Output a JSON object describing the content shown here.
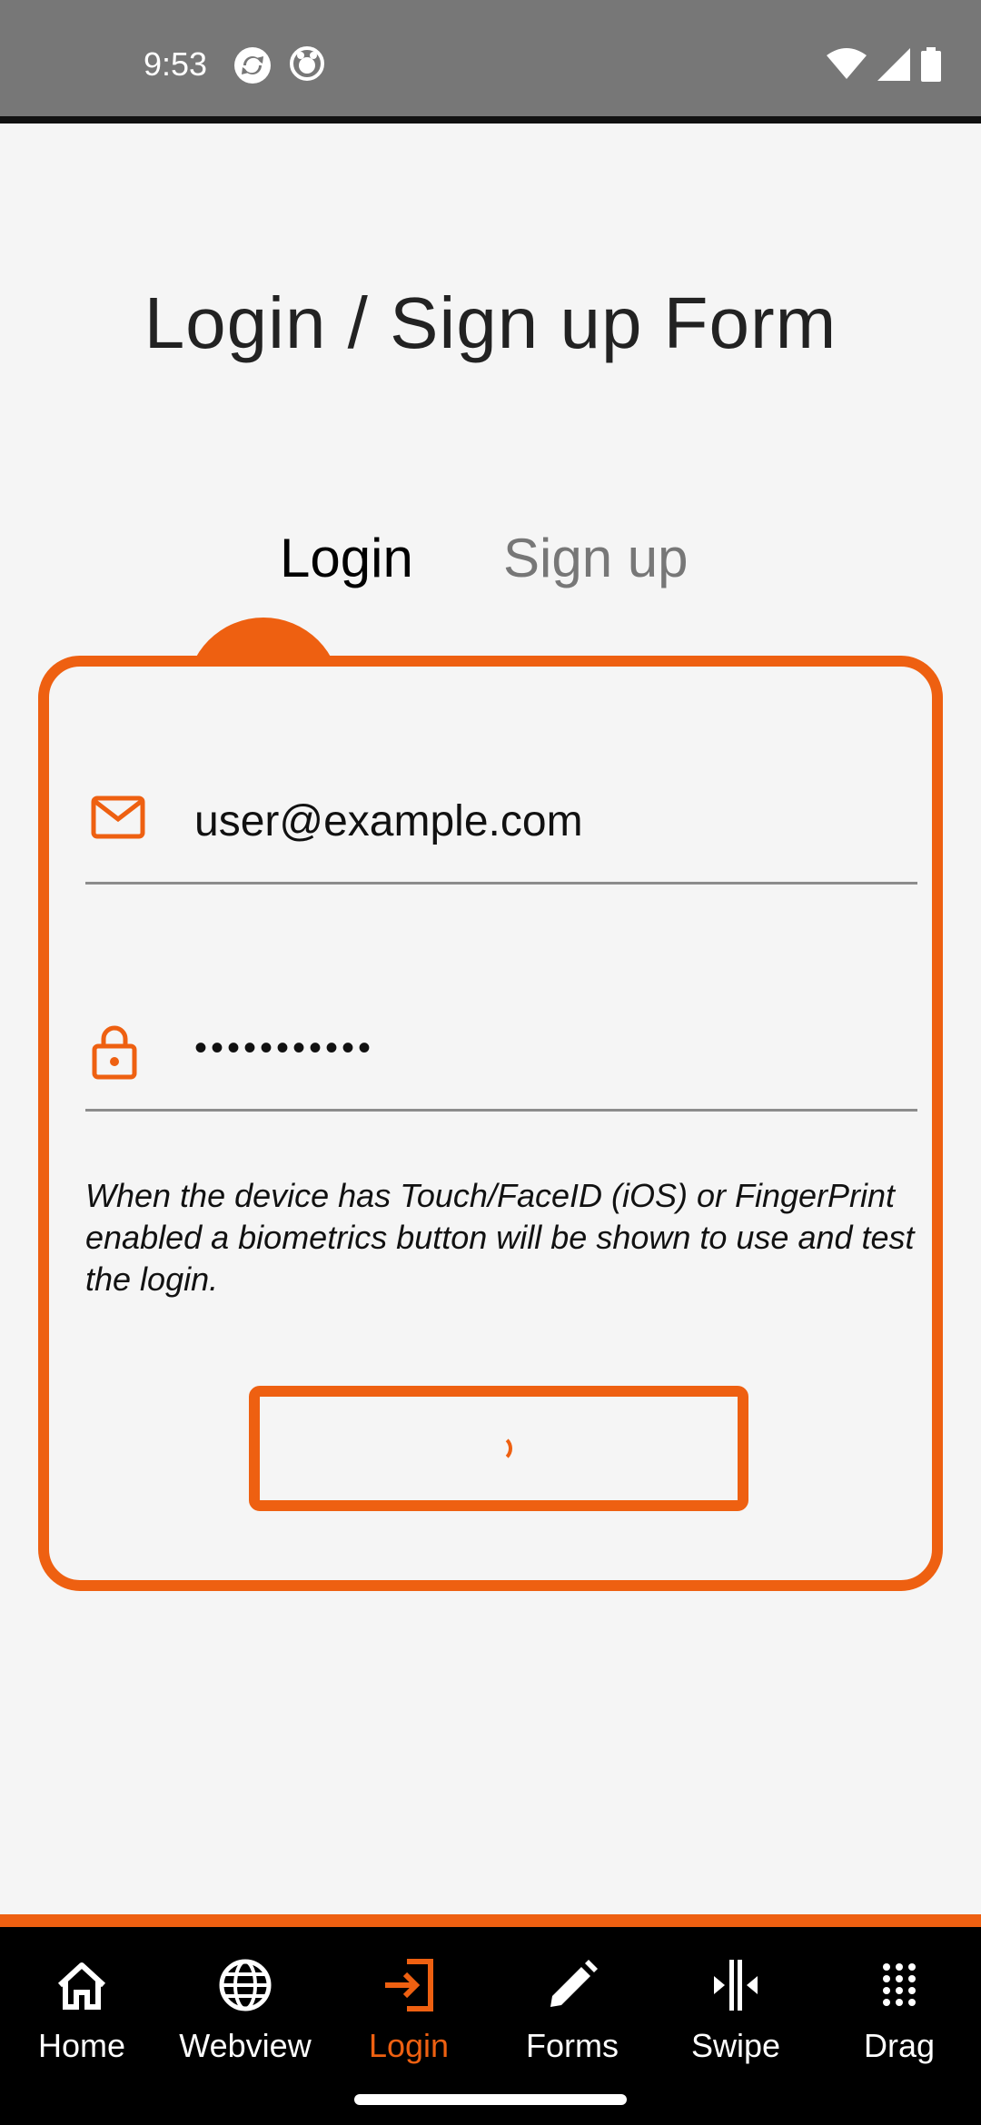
{
  "status_bar": {
    "time": "9:53",
    "left_icons": [
      "sync-icon",
      "app-icon"
    ],
    "right_icons": [
      "wifi-icon",
      "signal-icon",
      "battery-icon"
    ]
  },
  "title": "Login / Sign up Form",
  "tabs": [
    {
      "label": "Login",
      "active": true
    },
    {
      "label": "Sign up",
      "active": false
    }
  ],
  "form": {
    "email": {
      "icon": "mail-icon",
      "value": "user@example.com"
    },
    "password": {
      "icon": "lock-icon",
      "value": "•••••••••••"
    },
    "hint": "When the device has Touch/FaceID (iOS) or FingerPrint enabled a biometrics button will be shown to use and test the login.",
    "login_button_state": "loading"
  },
  "bottom_nav": {
    "items": [
      {
        "label": "Home",
        "icon": "home-icon",
        "active": false
      },
      {
        "label": "Webview",
        "icon": "globe-icon",
        "active": false
      },
      {
        "label": "Login",
        "icon": "login-icon",
        "active": true
      },
      {
        "label": "Forms",
        "icon": "pencil-icon",
        "active": false
      },
      {
        "label": "Swipe",
        "icon": "swipe-icon",
        "active": false
      },
      {
        "label": "Drag",
        "icon": "grid-icon",
        "active": false
      }
    ]
  },
  "colors": {
    "accent": "#ee6011",
    "background": "#f5f5f5",
    "status_bar": "#777777",
    "nav_background": "#000000"
  }
}
